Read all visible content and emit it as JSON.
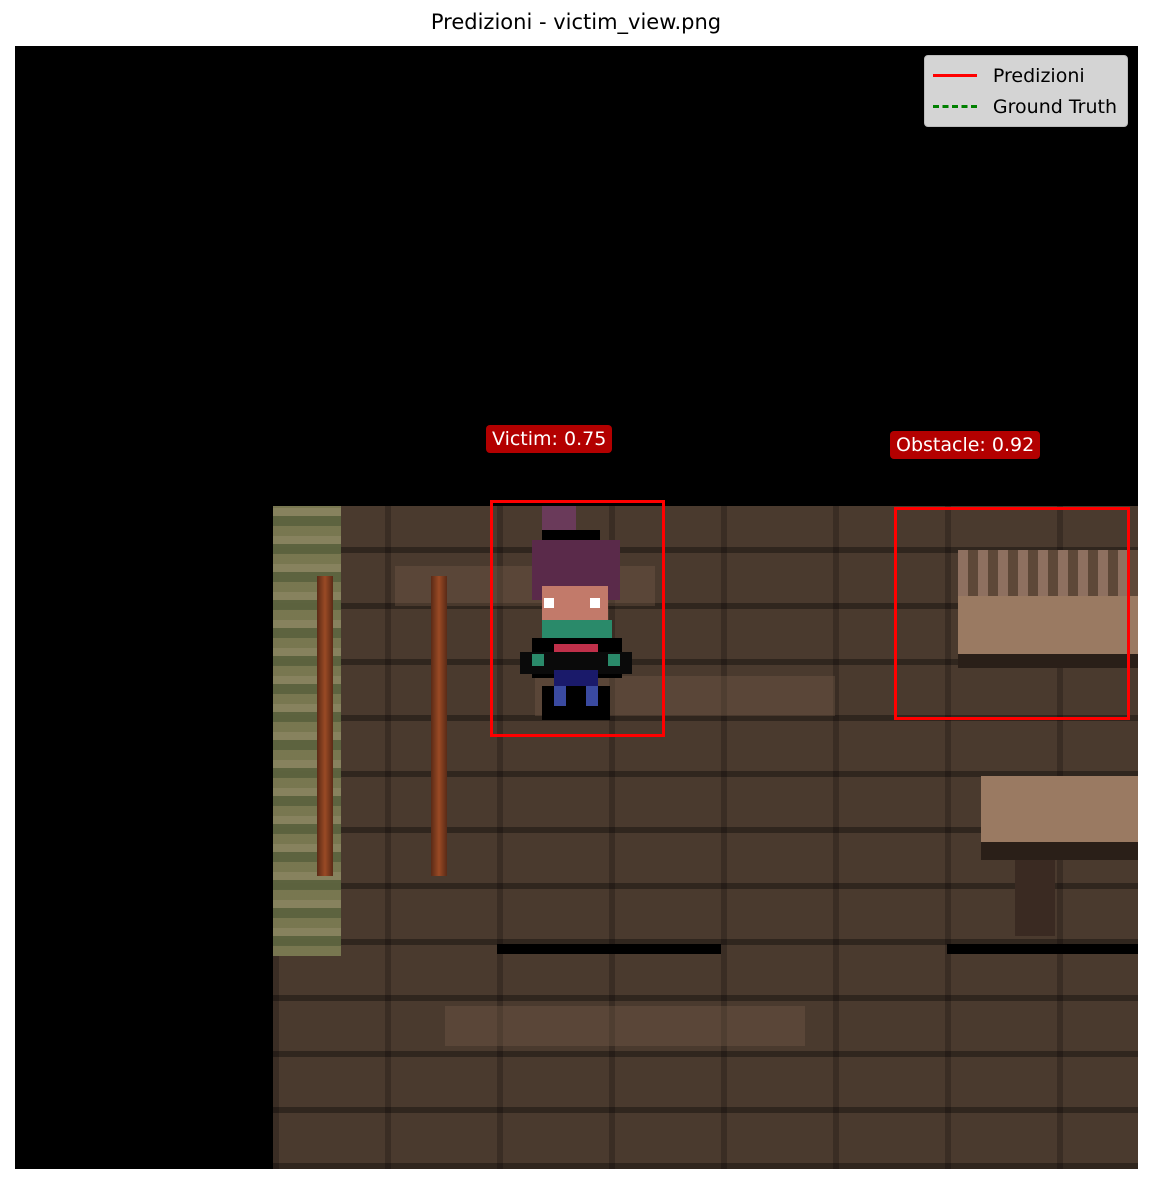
{
  "figure": {
    "title": "Predizioni - victim_view.png"
  },
  "legend": {
    "items": [
      {
        "label": "Predizioni",
        "style": "solid",
        "color": "#ff0000"
      },
      {
        "label": "Ground Truth",
        "style": "dashed",
        "color": "#008000"
      }
    ]
  },
  "detections": [
    {
      "label": "Victim: 0.75",
      "class": "Victim",
      "score": 0.75
    },
    {
      "label": "Obstacle: 0.92",
      "class": "Obstacle",
      "score": 0.92
    }
  ],
  "colors": {
    "box": "#ff0000",
    "label_bg": "#b30000",
    "background": "#000000"
  }
}
